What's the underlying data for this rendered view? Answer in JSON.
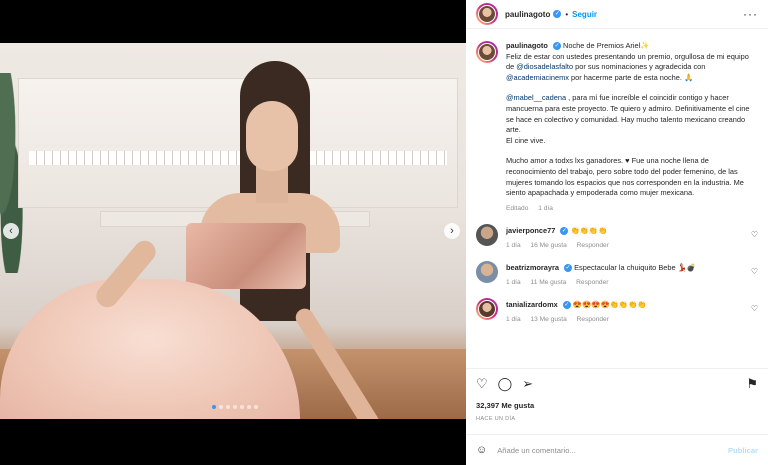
{
  "header": {
    "username": "paulinagoto",
    "separator": "•",
    "follow_label": "Seguir",
    "more_label": "···"
  },
  "caption": {
    "username": "paulinagoto",
    "line1": "Noche de Premios Ariel✨",
    "line2a": "Feliz de estar con ustedes presentando un premio, orgullosa de mi equipo de ",
    "mention1": "@diosadelasfalto",
    "line2b": " por sus nominaciones y agradecida con ",
    "mention2": "@academiacinemx",
    "line2c": " por hacerme parte de esta noche. 🙏",
    "mention3": "@mabel__cadena",
    "line3": " , para mí fue increíble el coincidir contigo y hacer mancuerna para este proyecto. Te quiero y admiro. Definitivamente el cine se hace en colectivo y comunidad. Hay mucho talento mexicano creando arte.",
    "line4": "El cine vive.",
    "line5": "Mucho amor a todxs lxs ganadores. ♥ Fue una noche llena de reconocimiento del trabajo, pero sobre todo del poder femenino, de las mujeres tomando los espacios que nos corresponden en la industria. Me siento apapachada y empoderada como mujer mexicana.",
    "edited": "Editado",
    "age": "1 día"
  },
  "comments": [
    {
      "user": "javierponce77",
      "text": "👏👏👏👏",
      "verified": true,
      "age": "1 día",
      "likes": "16 Me gusta",
      "reply": "Responder"
    },
    {
      "user": "beatrizmorayra",
      "text": "Espectacular la chuiquito Bebe 💃🏻💣",
      "verified": true,
      "age": "1 día",
      "likes": "11 Me gusta",
      "reply": "Responder"
    },
    {
      "user": "tanializardomx",
      "text": "😍😍😍😍👏👏👏👏",
      "verified": true,
      "age": "1 día",
      "likes": "13 Me gusta",
      "reply": "Responder"
    }
  ],
  "actions": {
    "likes": "32,397 Me gusta",
    "posted": "HACE UN DÍA"
  },
  "add_comment": {
    "placeholder": "Añade un comentario...",
    "publish": "Publicar"
  },
  "icons": [
    "heart-icon",
    "comment-icon",
    "share-icon",
    "bookmark-icon",
    "emoji-icon",
    "verified-icon"
  ],
  "colors": {
    "accent": "#0095f6",
    "mention": "#00376b",
    "muted": "#8e8e8e"
  }
}
